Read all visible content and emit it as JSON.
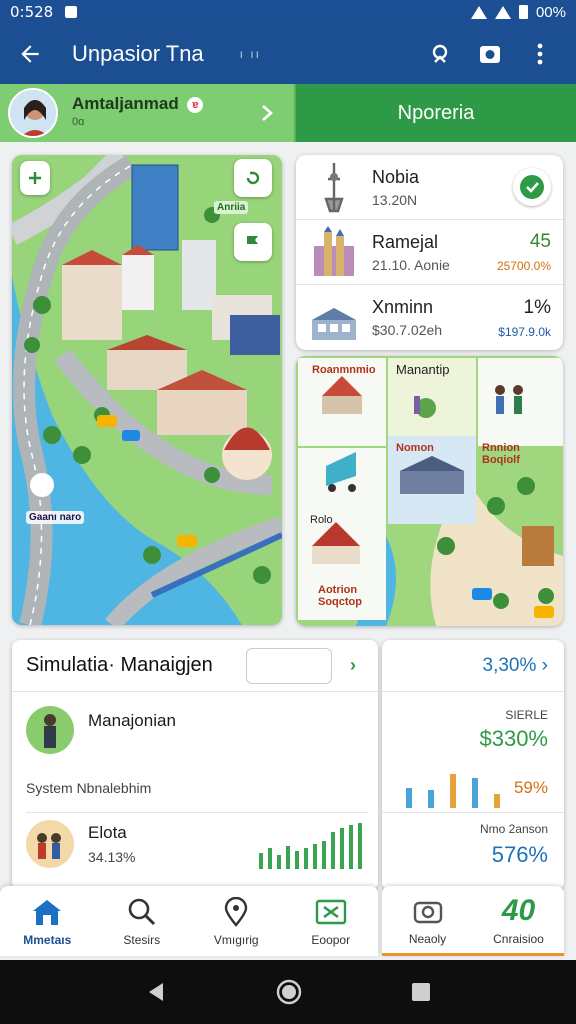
{
  "status_bar": {
    "time": "0:528",
    "battery": "00%"
  },
  "app_bar": {
    "title": "Unpasior Tna",
    "subtitle": "ı ıı"
  },
  "tabs": {
    "profile_label": "Amtaljanmad",
    "profile_sub": "0ɑ",
    "profile_badge": "ɐ",
    "active_tab": "Nporeria"
  },
  "map": {
    "label_top": "Anriia",
    "label_bottom": "Gaanı naro"
  },
  "stats": [
    {
      "name": "Nobia",
      "sub": "13.20N",
      "value": ""
    },
    {
      "name": "Ramejal",
      "sub": "21.10. Aonie",
      "value": "45",
      "delta": "25700.0%"
    },
    {
      "name": "Xnminn",
      "sub": "$30.7.02eh",
      "value": "1%",
      "delta": "$197.9.0k"
    }
  ],
  "palette": {
    "labels": [
      "Roanmnmio",
      "Manantip",
      "Nomon",
      "Rnnion Boqiolf",
      "Rolo",
      "Aotrion Soqctop"
    ]
  },
  "simulation": {
    "title": "Simulatia· Manaigjen",
    "go": "›",
    "item1": "Manajonian",
    "section": "System Nbnalebhim",
    "item2_name": "Elota",
    "item2_value": "34.13%",
    "bars": [
      0.35,
      0.45,
      0.3,
      0.5,
      0.4,
      0.45,
      0.55,
      0.6,
      0.8,
      0.9,
      0.95,
      1.0
    ]
  },
  "metrics": {
    "top": "3,30% ›",
    "label1": "SIERLE",
    "value1": "$330%",
    "label2": "59%",
    "label3": "Nmo 2anson",
    "value3": "576%",
    "bars": [
      {
        "level": 0.5,
        "color": "#4aa3d8"
      },
      {
        "level": 0.45,
        "color": "#4aa3d8"
      },
      {
        "level": 0.85,
        "color": "#e8a23a"
      },
      {
        "level": 0.75,
        "color": "#4aa3d8"
      },
      {
        "level": 0.35,
        "color": "#e8a23a"
      }
    ]
  },
  "bottom_nav": [
    {
      "label": "Mmetaıs"
    },
    {
      "label": "Stesirs"
    },
    {
      "label": "Vmıgırig"
    },
    {
      "label": "Eoopor"
    },
    {
      "label": "Neaoly"
    },
    {
      "label": "Cnraisioo",
      "icon_text": "40"
    }
  ],
  "colors": {
    "app_bar": "#1b4f91",
    "accent_green": "#2e9a47",
    "light_green": "#7fcd72"
  }
}
